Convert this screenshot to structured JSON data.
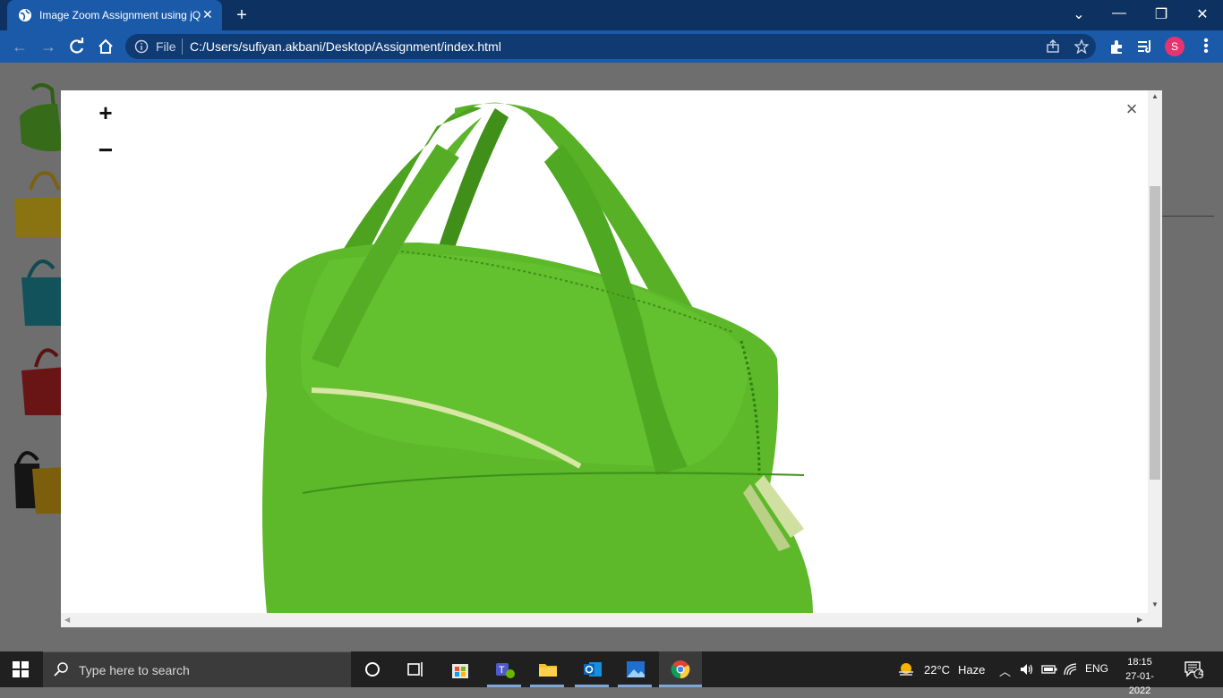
{
  "browser": {
    "tab_title": "Image Zoom Assignment using jQ",
    "tab_close": "✕",
    "new_tab": "+",
    "address_scheme_label": "File",
    "address_url": "C:/Users/sufiyan.akbani/Desktop/Assignment/index.html",
    "profile_initial": "S",
    "window_minimize": "—",
    "window_restore": "❐",
    "window_close": "✕",
    "tab_search": "⌄"
  },
  "modal": {
    "zoom_in_label": "+",
    "zoom_out_label": "−",
    "close_label": "×"
  },
  "taskbar": {
    "search_placeholder": "Type here to search",
    "weather_temp": "22°C",
    "weather_desc": "Haze",
    "language": "ENG",
    "time": "18:15",
    "date": "27-01-2022",
    "notification_count": "4"
  },
  "colors": {
    "chrome_dark": "#0d3160",
    "chrome_toolbar": "#1b5aa8",
    "bag_green": "#5db82a",
    "overlay": "#6e6e6e"
  }
}
